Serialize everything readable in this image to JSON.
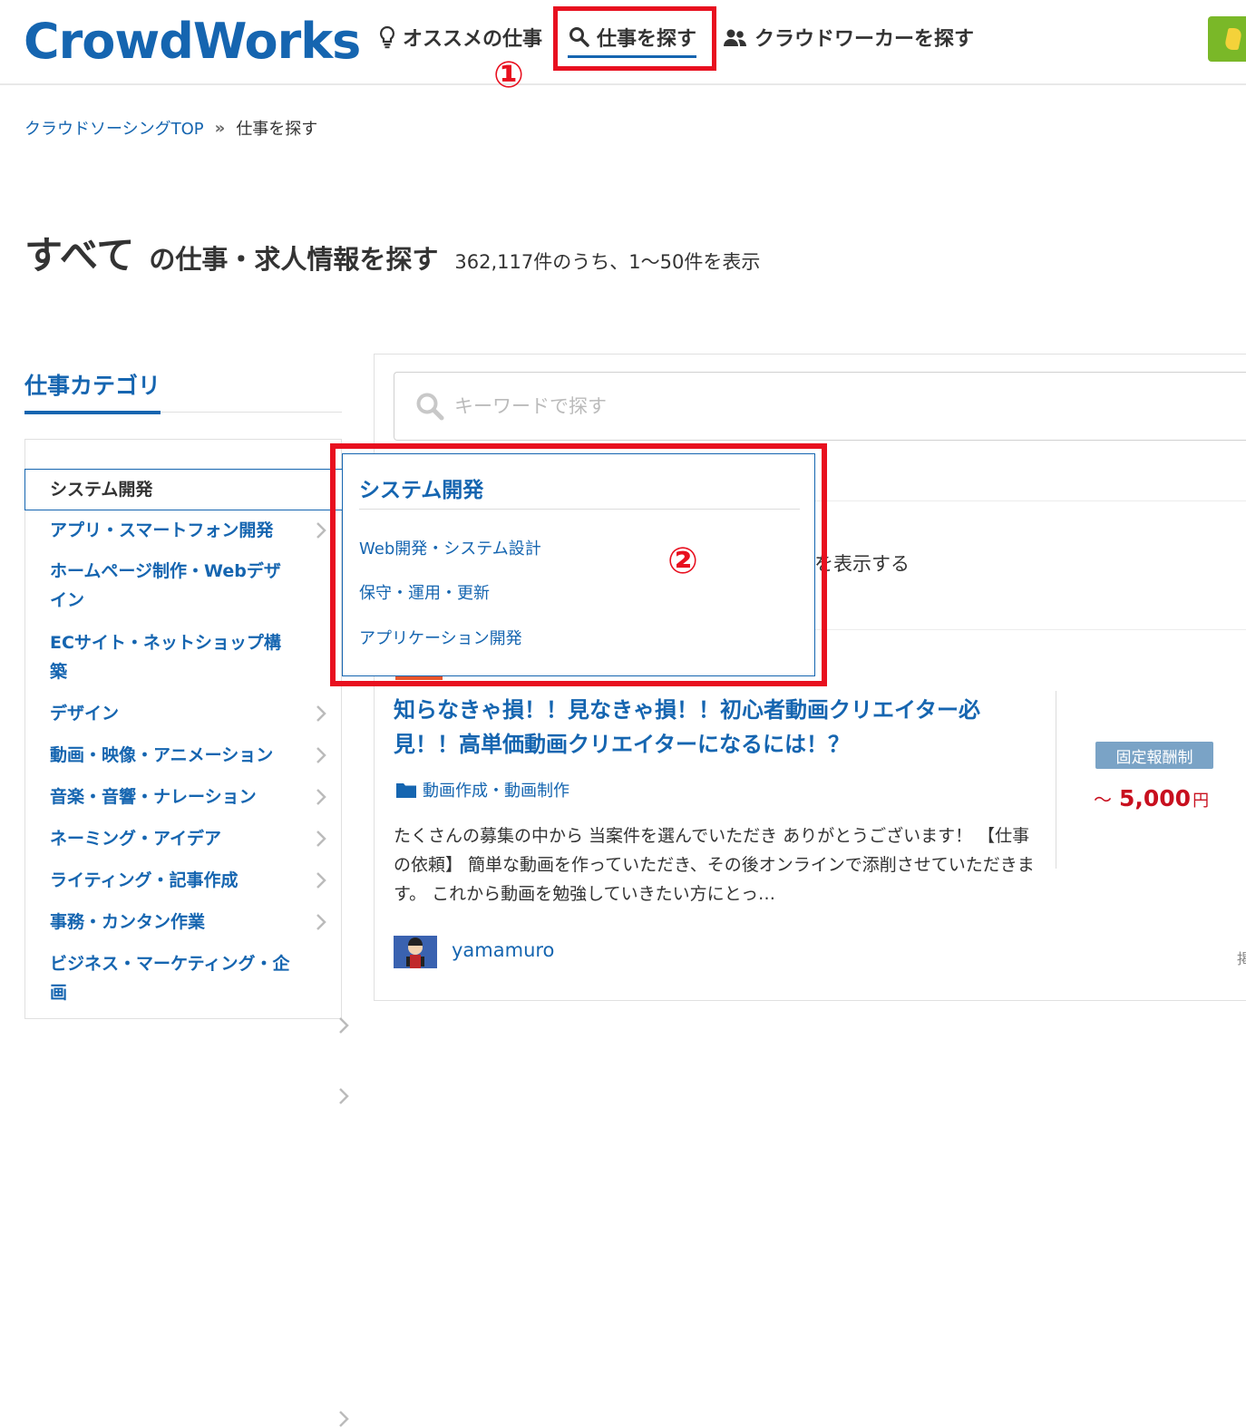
{
  "header": {
    "logo": "CrowdWorks",
    "nav": {
      "recommend": "オススメの仕事",
      "find_job": "仕事を探す",
      "find_worker": "クラウドワーカーを探す"
    }
  },
  "annotations": {
    "one": "①",
    "two": "②"
  },
  "breadcrumb": {
    "top": "クラウドソーシングTOP",
    "sep": "»",
    "current": "仕事を探す"
  },
  "title": {
    "big": "すべて",
    "mid": "の仕事・求人情報を探す",
    "count": "362,117件のうち、1～50件を表示"
  },
  "sidebar": {
    "heading": "仕事カテゴリ",
    "items": [
      "システム開発",
      "アプリ・スマートフォン開発",
      "ホームページ制作・Webデザイン",
      "ECサイト・ネットショップ構築",
      "デザイン",
      "動画・映像・アニメーション",
      "音楽・音響・ナレーション",
      "ネーミング・アイデア",
      "ライティング・記事作成",
      "事務・カンタン作業",
      "ビジネス・マーケティング・企画"
    ]
  },
  "search": {
    "placeholder": "キーワードで探す"
  },
  "partial_text": "を表示する",
  "flyout": {
    "title": "システム開発",
    "links": [
      "Web開発・システム設計",
      "保守・運用・更新",
      "アプリケーション開発"
    ]
  },
  "job": {
    "title": "知らなきゃ損！！見なきゃ損！！初心者動画クリエイター必見！！高単価動画クリエイターになるには！？",
    "category": "動画作成・動画制作",
    "description": "たくさんの募集の中から 当案件を選んでいただき ありがとうございます！ 【仕事の依頼】 簡単な動画を作っていただき、その後オンラインで添削させていただきます。 これから動画を勉強していきたい方にとっ…",
    "pay_type": "固定報酬制",
    "price_prefix": "～",
    "price": "5,000",
    "price_unit": "円",
    "client": "yamamuro",
    "edge_char": "掲"
  },
  "colors": {
    "brand": "#1565b0",
    "highlight": "#e8101f",
    "price": "#c8101f",
    "badge": "#7aa3c6"
  }
}
